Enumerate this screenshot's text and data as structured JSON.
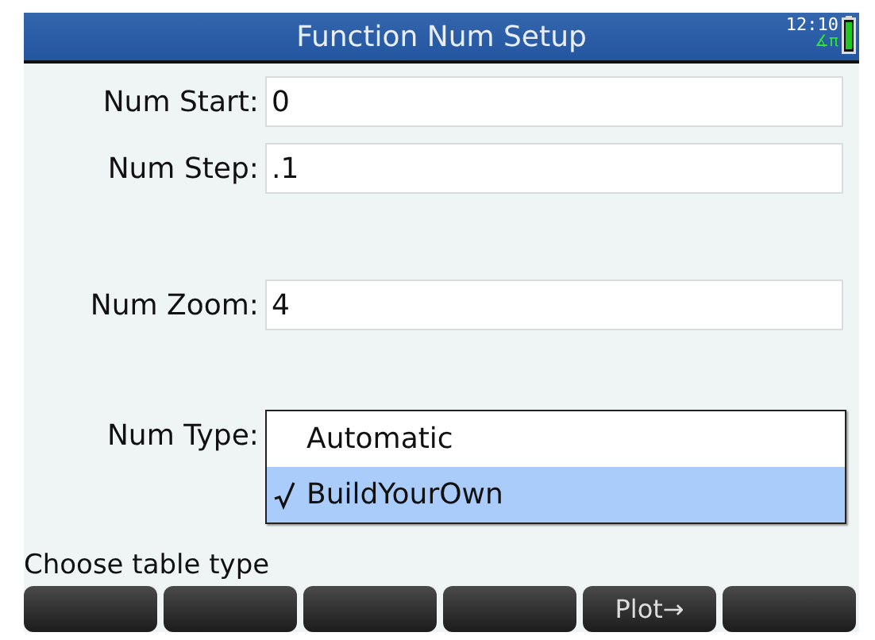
{
  "window": {
    "title": "Function Num Setup",
    "time": "12:10",
    "angle_mode": "∡π"
  },
  "fields": [
    {
      "label": "Num Start:",
      "value": "0"
    },
    {
      "label": "Num Step:",
      "value": ".1"
    },
    {
      "label": "Num Zoom:",
      "value": "4"
    }
  ],
  "num_type": {
    "label": "Num Type:",
    "options": [
      {
        "label": "Automatic",
        "selected": false
      },
      {
        "label": "BuildYourOwn",
        "selected": true
      }
    ]
  },
  "help": "Choose table type",
  "softkeys": [
    {
      "kind": "blank"
    },
    {
      "kind": "blank"
    },
    {
      "kind": "blank"
    },
    {
      "kind": "blank"
    },
    {
      "kind": "labeled",
      "label": "Plot→"
    },
    {
      "kind": "blank"
    }
  ]
}
